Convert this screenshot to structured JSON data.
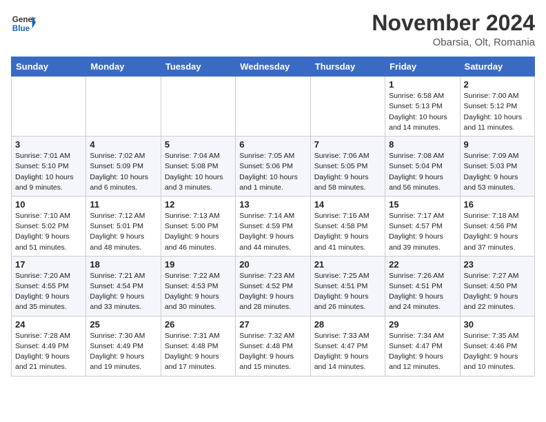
{
  "header": {
    "logo_line1": "General",
    "logo_line2": "Blue",
    "month": "November 2024",
    "location": "Obarsia, Olt, Romania"
  },
  "weekdays": [
    "Sunday",
    "Monday",
    "Tuesday",
    "Wednesday",
    "Thursday",
    "Friday",
    "Saturday"
  ],
  "weeks": [
    [
      {
        "day": "",
        "info": ""
      },
      {
        "day": "",
        "info": ""
      },
      {
        "day": "",
        "info": ""
      },
      {
        "day": "",
        "info": ""
      },
      {
        "day": "",
        "info": ""
      },
      {
        "day": "1",
        "info": "Sunrise: 6:58 AM\nSunset: 5:13 PM\nDaylight: 10 hours\nand 14 minutes."
      },
      {
        "day": "2",
        "info": "Sunrise: 7:00 AM\nSunset: 5:12 PM\nDaylight: 10 hours\nand 11 minutes."
      }
    ],
    [
      {
        "day": "3",
        "info": "Sunrise: 7:01 AM\nSunset: 5:10 PM\nDaylight: 10 hours\nand 9 minutes."
      },
      {
        "day": "4",
        "info": "Sunrise: 7:02 AM\nSunset: 5:09 PM\nDaylight: 10 hours\nand 6 minutes."
      },
      {
        "day": "5",
        "info": "Sunrise: 7:04 AM\nSunset: 5:08 PM\nDaylight: 10 hours\nand 3 minutes."
      },
      {
        "day": "6",
        "info": "Sunrise: 7:05 AM\nSunset: 5:06 PM\nDaylight: 10 hours\nand 1 minute."
      },
      {
        "day": "7",
        "info": "Sunrise: 7:06 AM\nSunset: 5:05 PM\nDaylight: 9 hours\nand 58 minutes."
      },
      {
        "day": "8",
        "info": "Sunrise: 7:08 AM\nSunset: 5:04 PM\nDaylight: 9 hours\nand 56 minutes."
      },
      {
        "day": "9",
        "info": "Sunrise: 7:09 AM\nSunset: 5:03 PM\nDaylight: 9 hours\nand 53 minutes."
      }
    ],
    [
      {
        "day": "10",
        "info": "Sunrise: 7:10 AM\nSunset: 5:02 PM\nDaylight: 9 hours\nand 51 minutes."
      },
      {
        "day": "11",
        "info": "Sunrise: 7:12 AM\nSunset: 5:01 PM\nDaylight: 9 hours\nand 48 minutes."
      },
      {
        "day": "12",
        "info": "Sunrise: 7:13 AM\nSunset: 5:00 PM\nDaylight: 9 hours\nand 46 minutes."
      },
      {
        "day": "13",
        "info": "Sunrise: 7:14 AM\nSunset: 4:59 PM\nDaylight: 9 hours\nand 44 minutes."
      },
      {
        "day": "14",
        "info": "Sunrise: 7:16 AM\nSunset: 4:58 PM\nDaylight: 9 hours\nand 41 minutes."
      },
      {
        "day": "15",
        "info": "Sunrise: 7:17 AM\nSunset: 4:57 PM\nDaylight: 9 hours\nand 39 minutes."
      },
      {
        "day": "16",
        "info": "Sunrise: 7:18 AM\nSunset: 4:56 PM\nDaylight: 9 hours\nand 37 minutes."
      }
    ],
    [
      {
        "day": "17",
        "info": "Sunrise: 7:20 AM\nSunset: 4:55 PM\nDaylight: 9 hours\nand 35 minutes."
      },
      {
        "day": "18",
        "info": "Sunrise: 7:21 AM\nSunset: 4:54 PM\nDaylight: 9 hours\nand 33 minutes."
      },
      {
        "day": "19",
        "info": "Sunrise: 7:22 AM\nSunset: 4:53 PM\nDaylight: 9 hours\nand 30 minutes."
      },
      {
        "day": "20",
        "info": "Sunrise: 7:23 AM\nSunset: 4:52 PM\nDaylight: 9 hours\nand 28 minutes."
      },
      {
        "day": "21",
        "info": "Sunrise: 7:25 AM\nSunset: 4:51 PM\nDaylight: 9 hours\nand 26 minutes."
      },
      {
        "day": "22",
        "info": "Sunrise: 7:26 AM\nSunset: 4:51 PM\nDaylight: 9 hours\nand 24 minutes."
      },
      {
        "day": "23",
        "info": "Sunrise: 7:27 AM\nSunset: 4:50 PM\nDaylight: 9 hours\nand 22 minutes."
      }
    ],
    [
      {
        "day": "24",
        "info": "Sunrise: 7:28 AM\nSunset: 4:49 PM\nDaylight: 9 hours\nand 21 minutes."
      },
      {
        "day": "25",
        "info": "Sunrise: 7:30 AM\nSunset: 4:49 PM\nDaylight: 9 hours\nand 19 minutes."
      },
      {
        "day": "26",
        "info": "Sunrise: 7:31 AM\nSunset: 4:48 PM\nDaylight: 9 hours\nand 17 minutes."
      },
      {
        "day": "27",
        "info": "Sunrise: 7:32 AM\nSunset: 4:48 PM\nDaylight: 9 hours\nand 15 minutes."
      },
      {
        "day": "28",
        "info": "Sunrise: 7:33 AM\nSunset: 4:47 PM\nDaylight: 9 hours\nand 14 minutes."
      },
      {
        "day": "29",
        "info": "Sunrise: 7:34 AM\nSunset: 4:47 PM\nDaylight: 9 hours\nand 12 minutes."
      },
      {
        "day": "30",
        "info": "Sunrise: 7:35 AM\nSunset: 4:46 PM\nDaylight: 9 hours\nand 10 minutes."
      }
    ]
  ]
}
